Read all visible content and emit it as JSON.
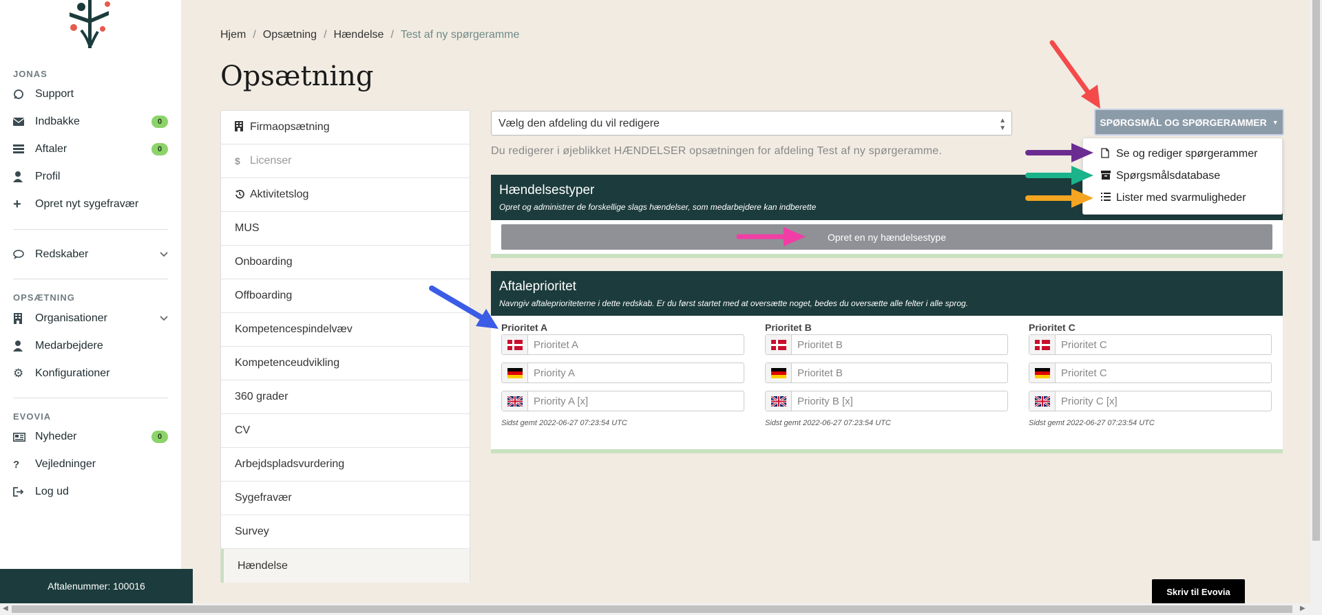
{
  "sidebar": {
    "section_user": "JONAS",
    "items_user": [
      {
        "icon": "support-icon",
        "label": "Support",
        "badge": ""
      },
      {
        "icon": "inbox-icon",
        "label": "Indbakke",
        "badge": "0"
      },
      {
        "icon": "agreements-icon",
        "label": "Aftaler",
        "badge": "0"
      },
      {
        "icon": "profile-icon",
        "label": "Profil",
        "badge": ""
      },
      {
        "icon": "plus-icon",
        "label": "Opret nyt sygefravær",
        "badge": ""
      }
    ],
    "tools": {
      "icon": "chat-bubble-icon",
      "label": "Redskaber"
    },
    "section_setup": "OPSÆTNING",
    "items_setup": [
      {
        "icon": "building-icon",
        "label": "Organisationer"
      },
      {
        "icon": "person-icon",
        "label": "Medarbejdere"
      },
      {
        "icon": "gear-icon",
        "label": "Konfigurationer"
      }
    ],
    "section_evovia": "EVOVIA",
    "items_evovia": [
      {
        "icon": "newspaper-icon",
        "label": "Nyheder",
        "badge": "0"
      },
      {
        "icon": "question-icon",
        "label": "Vejledninger",
        "badge": ""
      },
      {
        "icon": "logout-icon",
        "label": "Log ud",
        "badge": ""
      }
    ],
    "account_number": "Aftalenummer: 100016"
  },
  "breadcrumb": [
    "Hjem",
    "Opsætning",
    "Hændelse",
    "Test af ny spørgeramme"
  ],
  "page_title": "Opsætning",
  "subnav": [
    {
      "icon": "building-icon",
      "label": "Firmaopsætning"
    },
    {
      "icon": "dollar-icon",
      "label": "Licenser"
    },
    {
      "icon": "history-icon",
      "label": "Aktivitetslog"
    },
    {
      "label": "MUS"
    },
    {
      "label": "Onboarding"
    },
    {
      "label": "Offboarding"
    },
    {
      "label": "Kompetencespindelvæv"
    },
    {
      "label": "Kompetenceudvikling"
    },
    {
      "label": "360 grader"
    },
    {
      "label": "CV"
    },
    {
      "label": "Arbejdspladsvurdering"
    },
    {
      "label": "Sygefravær"
    },
    {
      "label": "Survey"
    },
    {
      "label": "Hændelse"
    }
  ],
  "dept_select": {
    "value": "Vælg den afdeling du vil redigere"
  },
  "questions_button": "SPØRGSMÅL OG SPØRGERAMMER",
  "dropdown": [
    {
      "icon": "file-icon",
      "label": "Se og rediger spørgerammer"
    },
    {
      "icon": "archive-icon",
      "label": "Spørgsmålsdatabase"
    },
    {
      "icon": "list-icon",
      "label": "Lister med svarmuligheder"
    }
  ],
  "info_text": "Du redigerer i øjeblikket HÆNDELSER opsætningen for afdeling Test af ny spørgeramme.",
  "event_types": {
    "title": "Hændelsestyper",
    "desc": "Opret og administrer de forskellige slags hændelser, som medarbejdere kan indberette",
    "button": "Opret en ny hændelsestype"
  },
  "priority": {
    "title": "Aftaleprioritet",
    "desc": "Navngiv aftaleprioriteterne i dette redskab. Er du først startet med at oversætte noget, bedes du oversætte alle felter i alle sprog.",
    "columns": [
      {
        "label": "Prioritet A",
        "fields": [
          {
            "flag": "dk",
            "value": "Prioritet A"
          },
          {
            "flag": "de",
            "value": "Priority A"
          },
          {
            "flag": "gb",
            "value": "Priority A [x]"
          }
        ],
        "saved": "Sidst gemt 2022-06-27 07:23:54 UTC"
      },
      {
        "label": "Prioritet B",
        "fields": [
          {
            "flag": "dk",
            "value": "Prioritet B"
          },
          {
            "flag": "de",
            "value": "Prioritet B"
          },
          {
            "flag": "gb",
            "value": "Priority B [x]"
          }
        ],
        "saved": "Sidst gemt 2022-06-27 07:23:54 UTC"
      },
      {
        "label": "Prioritet C",
        "fields": [
          {
            "flag": "dk",
            "value": "Prioritet C"
          },
          {
            "flag": "de",
            "value": "Prioritet C"
          },
          {
            "flag": "gb",
            "value": "Priority C [x]"
          }
        ],
        "saved": "Sidst gemt 2022-06-27 07:23:54 UTC"
      }
    ]
  },
  "chat_button": "Skriv til Evovia",
  "colors": {
    "brand_dark": "#1c3b3c",
    "badge_green": "#8cd36a",
    "accent_green": "#c8e1c0",
    "background": "#f1ebe2"
  }
}
